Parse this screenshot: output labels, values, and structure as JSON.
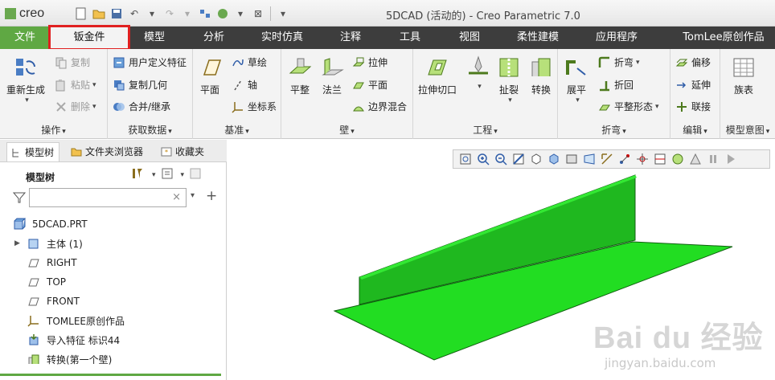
{
  "app": {
    "logo_text": "creo",
    "window_title": "5DCAD (活动的) - Creo Parametric 7.0"
  },
  "tabs": [
    {
      "label": "文件"
    },
    {
      "label": "钣金件"
    },
    {
      "label": "模型"
    },
    {
      "label": "分析"
    },
    {
      "label": "实时仿真"
    },
    {
      "label": "注释"
    },
    {
      "label": "工具"
    },
    {
      "label": "视图"
    },
    {
      "label": "柔性建模"
    },
    {
      "label": "应用程序"
    },
    {
      "label": "TomLee原创作品"
    }
  ],
  "ribbon": {
    "operations": {
      "label": "操作",
      "regenerate": "重新生成",
      "copy": "复制",
      "paste": "粘贴",
      "delete": "删除"
    },
    "get_data": {
      "label": "获取数据",
      "udf": "用户定义特征",
      "copy_geom": "复制几何",
      "merge": "合并/继承"
    },
    "datum": {
      "label": "基准",
      "plane": "平面",
      "sketch": "草绘",
      "axis": "轴",
      "csys": "坐标系"
    },
    "wall": {
      "label": "壁",
      "flat": "平整",
      "flange": "法兰",
      "extrude": "拉伸",
      "plane": "平面",
      "boundary_blend": "边界混合"
    },
    "engineering": {
      "label": "工程",
      "extrude_cut": "拉伸切口",
      "rip": "扯裂",
      "convert": "转换"
    },
    "bend": {
      "label": "折弯",
      "unbend": "展平",
      "bend": "折弯",
      "bend_back": "折回",
      "flatten_form": "平整形态"
    },
    "edit": {
      "label": "编辑",
      "offset": "偏移",
      "extend": "延伸",
      "join": "联接"
    },
    "model_intent": {
      "label": "模型意图",
      "family_table": "族表"
    }
  },
  "panel": {
    "tabs": [
      "模型树",
      "文件夹浏览器",
      "收藏夹"
    ],
    "tree_title": "模型树",
    "filter_value": "",
    "items": [
      {
        "label": "5DCAD.PRT"
      },
      {
        "label": "主体 (1)"
      },
      {
        "label": "RIGHT"
      },
      {
        "label": "TOP"
      },
      {
        "label": "FRONT"
      },
      {
        "label": "TOMLEE原创作品"
      },
      {
        "label": "导入特征 标识44"
      },
      {
        "label": "转换(第一个壁)"
      }
    ]
  },
  "watermark": {
    "line1": "Bai du 经验",
    "line2": "jingyan.baidu.com"
  },
  "colors": {
    "accent_green": "#5fa843",
    "tab_bar": "#3d3d3d",
    "highlight_red": "#e02020",
    "model_green": "#22dd22"
  }
}
